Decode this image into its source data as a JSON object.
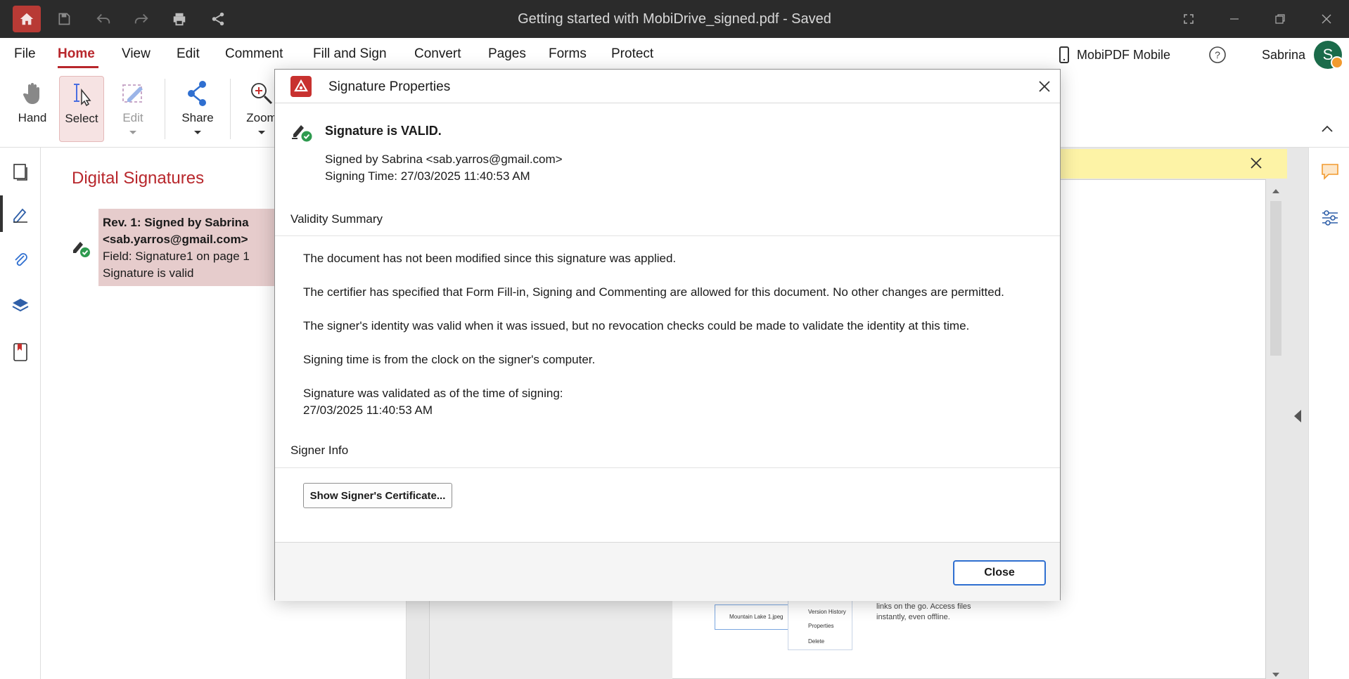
{
  "window": {
    "title": "Getting started with MobiDrive_signed.pdf - Saved"
  },
  "menu": {
    "tabs": [
      "File",
      "Home",
      "View",
      "Edit",
      "Comment",
      "Fill and Sign",
      "Convert",
      "Pages",
      "Forms",
      "Protect"
    ],
    "active_tab": "Home",
    "mobile_label": "MobiPDF Mobile",
    "user_name": "Sabrina",
    "avatar_initial": "S"
  },
  "ribbon": {
    "hand": "Hand",
    "select": "Select",
    "edit": "Edit",
    "share": "Share",
    "zoom": "Zoom"
  },
  "sig_panel": {
    "title": "Digital Signatures",
    "entry": {
      "line1": "Rev. 1: Signed by Sabrina",
      "line2": "<sab.yarros@gmail.com>",
      "line3": "Field: Signature1 on page 1",
      "line4": "Signature is valid"
    }
  },
  "thumbnail": {
    "file_name": "Mountain Lake 1.jpeg",
    "menu_items": [
      "Version History",
      "Properties",
      "Delete"
    ],
    "text": "links on the go. Access files instantly, even offline."
  },
  "dialog": {
    "title": "Signature Properties",
    "status": "Signature is VALID.",
    "signed_by": "Signed by Sabrina <sab.yarros@gmail.com>",
    "signing_time": "Signing Time: 27/03/2025 11:40:53 AM",
    "validity_heading": "Validity Summary",
    "validity_lines": [
      "The document has not been modified since this signature was applied.",
      "The certifier has specified that Form Fill-in, Signing and Commenting are allowed for this document. No other changes are permitted.",
      "The signer's identity was valid when it was issued, but no revocation checks could be made to validate the identity at this time.",
      "Signing time is from the clock on the signer's computer.",
      "Signature was validated as of the time of signing:",
      "27/03/2025 11:40:53 AM"
    ],
    "signer_heading": "Signer Info",
    "cert_button": "Show Signer's Certificate...",
    "close_button": "Close"
  },
  "colors": {
    "accent": "#b8272c",
    "titlebar": "#2b2b2b",
    "valid_green": "#2e9a4f",
    "focus_blue": "#2f6fd0"
  }
}
